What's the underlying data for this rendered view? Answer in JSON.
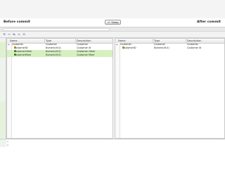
{
  "header": {
    "before_label": "Before commit",
    "after_label": "After commit",
    "swap_label": "Swap"
  },
  "toolbar": {
    "icons": [
      "expand-all-icon",
      "align-left-icon",
      "align-center-icon",
      "sort-icon",
      "sidebyside-icon"
    ]
  },
  "left_table": {
    "columns": [
      "Name",
      "Type",
      "Description"
    ],
    "rows": [
      {
        "name": "Customer",
        "type": "Customer",
        "desc": "Customer"
      },
      {
        "name": "CustomerID",
        "type": "Numeric(9.0)",
        "desc": "Customer Id"
      },
      {
        "name": "CustomerOther",
        "type": "Numeric(9.0)",
        "desc": "Customer Other"
      },
      {
        "name": "CustomerMore",
        "type": "Numeric(9.0)",
        "desc": "Customer More"
      }
    ]
  },
  "right_table": {
    "columns": [
      "Name",
      "Type",
      "Description"
    ],
    "rows": [
      {
        "name": "Customer",
        "type": "Customer",
        "desc": "Customer"
      },
      {
        "name": "CustomerID",
        "type": "Numeric(9.0)",
        "desc": "Customer Id"
      }
    ]
  },
  "colors": {
    "added_row": "#d6f0c0",
    "header_bg": "#e6e6e6",
    "gutter": "#eef3ee"
  }
}
